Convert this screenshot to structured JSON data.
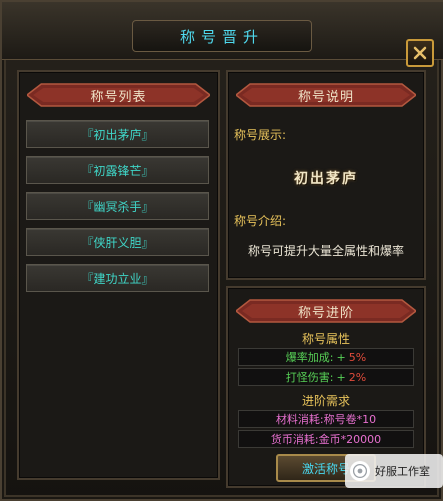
{
  "window": {
    "title": "称号晋升"
  },
  "list_panel": {
    "header": "称号列表",
    "items": [
      "『初出茅庐』",
      "『初露锋芒』",
      "『幽冥杀手』",
      "『侠肝义胆』",
      "『建功立业』"
    ]
  },
  "info_panel": {
    "header": "称号说明",
    "display_label": "称号展示:",
    "display_title": "初出茅庐",
    "intro_label": "称号介绍:",
    "intro_text": "称号可提升大量全属性和爆率"
  },
  "advance_panel": {
    "header": "称号进阶",
    "attr_head": "称号属性",
    "stats": [
      {
        "name": "爆率加成:",
        "plus": "+",
        "value": "5%"
      },
      {
        "name": "打怪伤害:",
        "plus": "+",
        "value": "2%"
      }
    ],
    "req_head": "进阶需求",
    "requirements": [
      {
        "text": "材料消耗:称号卷*10"
      },
      {
        "text": "货币消耗:金币*20000"
      }
    ],
    "button": "激活称号"
  },
  "watermark": {
    "text": "好服工作室"
  },
  "colors": {
    "cyan": "#4fd9ee",
    "gold": "#e8c35b",
    "green": "#58d257",
    "pink": "#e770cf",
    "red": "#e04b3b"
  }
}
